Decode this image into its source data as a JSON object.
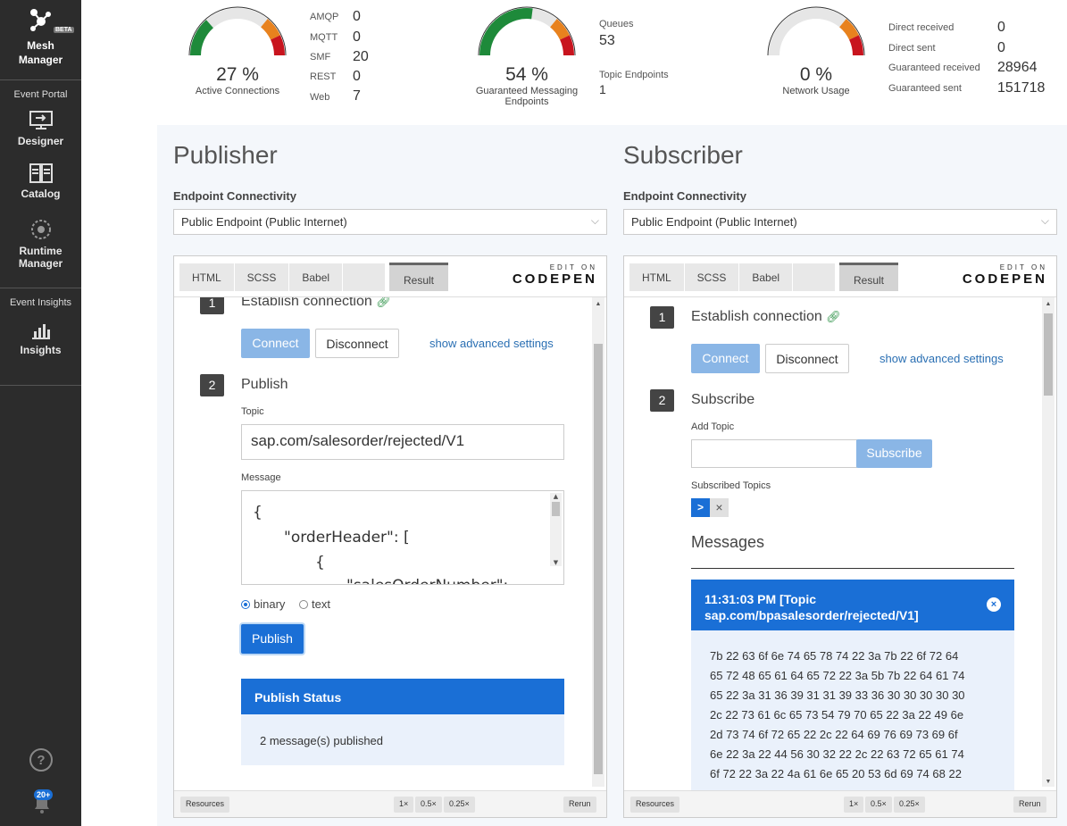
{
  "sidebar": {
    "brand": {
      "line1": "Mesh",
      "line2": "Manager",
      "badge": "BETA"
    },
    "sections": [
      {
        "title": "Event Portal",
        "items": [
          {
            "label": "Designer",
            "icon": "designer-icon"
          },
          {
            "label": "Catalog",
            "icon": "catalog-icon"
          },
          {
            "label": "Runtime",
            "label2": "Manager",
            "icon": "globe-icon"
          }
        ]
      },
      {
        "title": "Event Insights",
        "items": [
          {
            "label": "Insights",
            "icon": "bar-chart-icon"
          }
        ]
      }
    ],
    "help_icon": "help-icon",
    "notification_badge": "20+"
  },
  "stats": {
    "gauges": [
      {
        "pct": "27 %",
        "label": "Active Connections",
        "fill": 0.27
      },
      {
        "pct": "54 %",
        "label": "Guaranteed Messaging",
        "label2": "Endpoints",
        "fill": 0.54
      },
      {
        "pct": "0 %",
        "label": "Network Usage",
        "fill": 0.0
      }
    ],
    "connections": [
      {
        "k": "AMQP",
        "v": "0"
      },
      {
        "k": "MQTT",
        "v": "0"
      },
      {
        "k": "SMF",
        "v": "20"
      },
      {
        "k": "REST",
        "v": "0"
      },
      {
        "k": "Web",
        "v": "7"
      }
    ],
    "endpoints": [
      {
        "k": "Queues",
        "v": "53"
      },
      {
        "k": "Topic Endpoints",
        "v": "1"
      }
    ],
    "network": [
      {
        "k": "Direct received",
        "v": "0"
      },
      {
        "k": "Direct sent",
        "v": "0"
      },
      {
        "k": "Guaranteed received",
        "v": "28964"
      },
      {
        "k": "Guaranteed sent",
        "v": "151718"
      }
    ],
    "colors": {
      "green": "#1e8a3a",
      "orange": "#e8821e",
      "red": "#c8141e",
      "track": "#e6e6e6"
    }
  },
  "codepen": {
    "tabs": [
      "HTML",
      "SCSS",
      "Babel"
    ],
    "result": "Result",
    "edit_on": "EDIT ON",
    "brand": "CODEPEN",
    "footer": {
      "resources": "Resources",
      "z1": "1×",
      "z05": "0.5×",
      "z025": "0.25×",
      "rerun": "Rerun"
    }
  },
  "publisher": {
    "title": "Publisher",
    "endpoint_label": "Endpoint Connectivity",
    "endpoint_value": "Public Endpoint  (Public Internet)",
    "step1": {
      "num": "1",
      "title": "Establish connection"
    },
    "connect": "Connect",
    "disconnect": "Disconnect",
    "advanced": "show advanced settings",
    "step2": {
      "num": "2",
      "title": "Publish"
    },
    "topic_label": "Topic",
    "topic_value": "sap.com/salesorder/rejected/V1",
    "message_label": "Message",
    "message_lines": [
      "{",
      "\"orderHeader\": [",
      "{",
      "\"salesOrderNumber\":"
    ],
    "radio_binary": "binary",
    "radio_text": "text",
    "publish": "Publish",
    "status_title": "Publish Status",
    "status_text": "2 message(s) published"
  },
  "subscriber": {
    "title": "Subscriber",
    "endpoint_label": "Endpoint Connectivity",
    "endpoint_value": "Public Endpoint  (Public Internet)",
    "step1": {
      "num": "1",
      "title": "Establish connection"
    },
    "connect": "Connect",
    "disconnect": "Disconnect",
    "advanced": "show advanced settings",
    "step2": {
      "num": "2",
      "title": "Subscribe"
    },
    "add_topic_label": "Add Topic",
    "add_topic_value": "",
    "subscribe": "Subscribe",
    "subscribed_label": "Subscribed Topics",
    "topic_chip": ">",
    "chip_remove": "×",
    "messages_title": "Messages",
    "message": {
      "header1": "11:31:03 PM [Topic",
      "header2": "sap.com/bpasalesorder/rejected/V1]",
      "close": "×",
      "lines": [
        "7b 22 63 6f 6e 74 65 78 74 22 3a 7b 22 6f 72 64",
        "65 72 48 65 61 64 65 72 22 3a 5b 7b 22 64 61 74",
        "65 22 3a 31 36 39 31 31 39 33 36 30 30 30 30 30",
        "2c 22 73 61 6c 65 73 54 79 70 65 22 3a 22 49 6e",
        "2d 73 74 6f 72 65 22 2c 22 64 69 76 69 73 69 6f",
        "6e 22 3a 22 44 56 30 32 22 2c 22 63 72 65 61 74",
        "6f 72 22 3a 22 4a 61 6e 65 20 53 6d 69 74 68 22"
      ]
    }
  }
}
